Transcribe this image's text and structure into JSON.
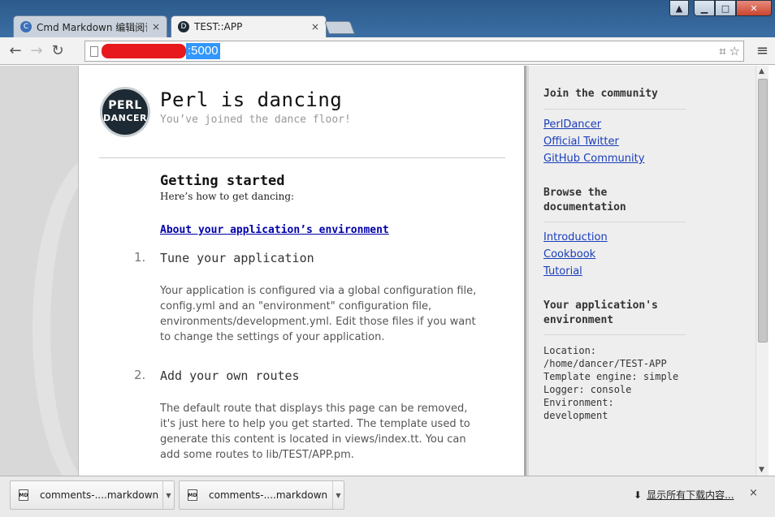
{
  "browser": {
    "tabs": [
      {
        "title": "Cmd Markdown 编辑阅读器",
        "close": "×"
      },
      {
        "title": "TEST::APP",
        "close": "×"
      }
    ],
    "url_highlight": ":5000",
    "nav": {
      "back": "←",
      "forward": "→",
      "reload": "↻"
    },
    "omnibox_icons": {
      "translate": "⌗",
      "star": "☆"
    },
    "menu": "≡",
    "window_controls": {
      "user": "▲",
      "minimize": "▁",
      "maximize": "□",
      "close": "✕"
    }
  },
  "page": {
    "logo": {
      "line1": "PERL",
      "line2": "DANCER"
    },
    "title": "Perl is dancing",
    "subtitle": "You’ve joined the dance floor!",
    "getting_started": {
      "title": "Getting started",
      "subtitle": "Here’s how to get dancing:",
      "env_link": "About your application’s environment"
    },
    "steps": [
      {
        "num": "1.",
        "title": "Tune your application",
        "body": "Your application is configured via a global configuration file, config.yml and an \"environment\" configuration file, environments/development.yml. Edit those files if you want to change the settings of your application."
      },
      {
        "num": "2.",
        "title": "Add your own routes",
        "body": "The default route that displays this page can be removed, it's just here to help you get started. The template used to generate this content is located in views/index.tt. You can add some routes to lib/TEST/APP.pm."
      }
    ]
  },
  "sidebar": {
    "community": {
      "heading": "Join the community",
      "links": [
        "PerlDancer",
        "Official Twitter",
        "GitHub Community"
      ]
    },
    "docs": {
      "heading": "Browse the documentation",
      "links": [
        "Introduction",
        "Cookbook",
        "Tutorial"
      ]
    },
    "env": {
      "heading": "Your application's environment",
      "location_label": "Location:",
      "location": "/home/dancer/TEST-APP",
      "template": "Template engine: simple",
      "logger": "Logger: console",
      "environment_label": "Environment:",
      "environment": "development"
    }
  },
  "downloads": {
    "items": [
      {
        "name": "comments-....markdown",
        "icon": "MD"
      },
      {
        "name": "comments-....markdown",
        "icon": "MD"
      }
    ],
    "show_all": "显示所有下载内容...",
    "close": "×"
  },
  "colors": {
    "accent_link": "#1a3dbb",
    "url_select": "#3297fd",
    "redaction": "#e8191c"
  }
}
